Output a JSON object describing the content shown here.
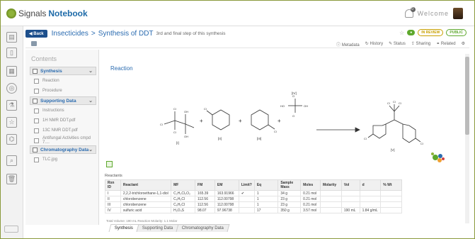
{
  "header": {
    "brand_prefix": "Signals",
    "brand_name": "Notebook",
    "welcome": "Welcome",
    "notifications": "0"
  },
  "titlebar": {
    "back_label": "Back",
    "breadcrumb_parent": "Insecticides",
    "breadcrumb_sep": ">",
    "breadcrumb_current": "Synthesis of DDT",
    "subtitle": "3rd and final step of this synthesis",
    "status_pill": "●",
    "review_pill": "IN REVIEW",
    "public_pill": "PUBLIC"
  },
  "tools": [
    "Metadata",
    "History",
    "Status",
    "Sharing",
    "Related"
  ],
  "contents": {
    "title": "Contents",
    "sections": [
      {
        "label": "Synthesis",
        "items": [
          "Reaction",
          "Procedure"
        ]
      },
      {
        "label": "Supporting Data",
        "items": [
          "Instructions",
          "1H NMR DDT.pdf",
          "13C NMR DDT.pdf",
          "Antifungal Activities cmpd 7...."
        ]
      },
      {
        "label": "Chromatography Data",
        "items": [
          "TLC.jpg"
        ]
      }
    ]
  },
  "main": {
    "title": "Reaction",
    "labels": [
      "[I]",
      "[II]",
      "[III]",
      "[IV]",
      "[V]"
    ],
    "reactants_label": "Reactants",
    "columns": [
      "Rxn ID",
      "Reactant",
      "MF",
      "FM",
      "EM",
      "Limit?",
      "Eq",
      "Sample Mass",
      "Moles",
      "Molarity",
      "Vol",
      "d",
      "% Wt"
    ],
    "rows": [
      [
        "I",
        "2,2,2-trichloroethane-1,1-diol",
        "C₂H₃Cl₃O₂",
        "165.39",
        "163.91966",
        "✔",
        "1",
        "34 g",
        "0.21 mol",
        "",
        "",
        "",
        ""
      ],
      [
        "II",
        "chlorobenzene",
        "C₆H₅Cl",
        "112.56",
        "112.00798",
        "",
        "1",
        "23 g",
        "0.21 mol",
        "",
        "",
        "",
        ""
      ],
      [
        "III",
        "chlorobenzene",
        "C₆H₅Cl",
        "112.56",
        "112.00798",
        "",
        "1",
        "23 g",
        "0.21 mol",
        "",
        "",
        "",
        ""
      ],
      [
        "IV",
        "sulfuric acid",
        "H₂O₄S",
        "98.07",
        "97.96738",
        "",
        "17",
        "350 g",
        "3.57 mol",
        "",
        "190 mL",
        "1.84 g/mL",
        ""
      ]
    ],
    "totals": "Total Volume: 190 mL  Reaction Molarity: 1.1 Molar"
  },
  "tabs": [
    "Synthesis",
    "Supporting Data",
    "Chromatography Data"
  ],
  "colors": {
    "brand": "#1d6aa8",
    "accent": "#5ea82d",
    "link": "#2a6bb0"
  }
}
